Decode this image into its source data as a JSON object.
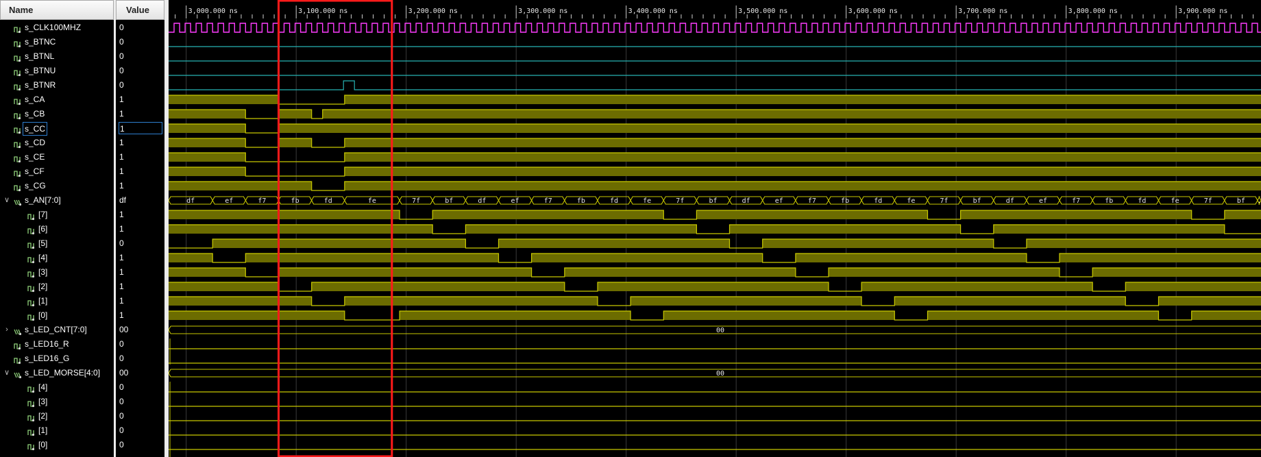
{
  "columns": {
    "name": "Name",
    "value": "Value"
  },
  "signals": [
    {
      "name": "s_CLK100MHZ",
      "value": "0",
      "kind": "bit",
      "indent": 0,
      "expander": ""
    },
    {
      "name": "s_BTNC",
      "value": "0",
      "kind": "bit",
      "indent": 0,
      "expander": ""
    },
    {
      "name": "s_BTNL",
      "value": "0",
      "kind": "bit",
      "indent": 0,
      "expander": ""
    },
    {
      "name": "s_BTNU",
      "value": "0",
      "kind": "bit",
      "indent": 0,
      "expander": ""
    },
    {
      "name": "s_BTNR",
      "value": "0",
      "kind": "bit",
      "indent": 0,
      "expander": ""
    },
    {
      "name": "s_CA",
      "value": "1",
      "kind": "bit",
      "indent": 0,
      "expander": ""
    },
    {
      "name": "s_CB",
      "value": "1",
      "kind": "bit",
      "indent": 0,
      "expander": ""
    },
    {
      "name": "s_CC",
      "value": "1",
      "kind": "bit",
      "indent": 0,
      "expander": "",
      "selected": true
    },
    {
      "name": "s_CD",
      "value": "1",
      "kind": "bit",
      "indent": 0,
      "expander": ""
    },
    {
      "name": "s_CE",
      "value": "1",
      "kind": "bit",
      "indent": 0,
      "expander": ""
    },
    {
      "name": "s_CF",
      "value": "1",
      "kind": "bit",
      "indent": 0,
      "expander": ""
    },
    {
      "name": "s_CG",
      "value": "1",
      "kind": "bit",
      "indent": 0,
      "expander": ""
    },
    {
      "name": "s_AN[7:0]",
      "value": "df",
      "kind": "bus",
      "indent": 0,
      "expander": "expanded"
    },
    {
      "name": "[7]",
      "value": "1",
      "kind": "bit",
      "indent": 1,
      "expander": ""
    },
    {
      "name": "[6]",
      "value": "1",
      "kind": "bit",
      "indent": 1,
      "expander": ""
    },
    {
      "name": "[5]",
      "value": "0",
      "kind": "bit",
      "indent": 1,
      "expander": ""
    },
    {
      "name": "[4]",
      "value": "1",
      "kind": "bit",
      "indent": 1,
      "expander": ""
    },
    {
      "name": "[3]",
      "value": "1",
      "kind": "bit",
      "indent": 1,
      "expander": ""
    },
    {
      "name": "[2]",
      "value": "1",
      "kind": "bit",
      "indent": 1,
      "expander": ""
    },
    {
      "name": "[1]",
      "value": "1",
      "kind": "bit",
      "indent": 1,
      "expander": ""
    },
    {
      "name": "[0]",
      "value": "1",
      "kind": "bit",
      "indent": 1,
      "expander": ""
    },
    {
      "name": "s_LED_CNT[7:0]",
      "value": "00",
      "kind": "bus",
      "indent": 0,
      "expander": "collapsed"
    },
    {
      "name": "s_LED16_R",
      "value": "0",
      "kind": "bit",
      "indent": 0,
      "expander": ""
    },
    {
      "name": "s_LED16_G",
      "value": "0",
      "kind": "bit",
      "indent": 0,
      "expander": ""
    },
    {
      "name": "s_LED_MORSE[4:0]",
      "value": "00",
      "kind": "bus",
      "indent": 0,
      "expander": "expanded"
    },
    {
      "name": "[4]",
      "value": "0",
      "kind": "bit",
      "indent": 1,
      "expander": ""
    },
    {
      "name": "[3]",
      "value": "0",
      "kind": "bit",
      "indent": 1,
      "expander": ""
    },
    {
      "name": "[2]",
      "value": "0",
      "kind": "bit",
      "indent": 1,
      "expander": ""
    },
    {
      "name": "[1]",
      "value": "0",
      "kind": "bit",
      "indent": 1,
      "expander": ""
    },
    {
      "name": "[0]",
      "value": "0",
      "kind": "bit",
      "indent": 1,
      "expander": ""
    }
  ],
  "timeline": {
    "unit": "ns",
    "start": 2984,
    "end": 3980,
    "ticks": [
      "3,000.000 ns",
      "3,100.000 ns",
      "3,200.000 ns",
      "3,300.000 ns",
      "3,400.000 ns",
      "3,500.000 ns",
      "3,600.000 ns",
      "3,700.000 ns",
      "3,800.000 ns",
      "3,900.000 ns"
    ],
    "tick_values": [
      3000,
      3100,
      3200,
      3300,
      3400,
      3500,
      3600,
      3700,
      3800,
      3900
    ],
    "highlight_range": [
      3084,
      3187
    ]
  },
  "clock": {
    "period": 10
  },
  "waves": {
    "s_BTNR": [
      [
        3143,
        1
      ],
      [
        3153,
        0
      ]
    ],
    "s_CA": [
      [
        3084,
        0
      ],
      [
        3144,
        1
      ]
    ],
    "s_CB": [
      [
        3054,
        0
      ],
      [
        3084,
        1
      ],
      [
        3114,
        0
      ],
      [
        3124,
        1
      ]
    ],
    "s_CC": [
      [
        3054,
        0
      ],
      [
        3084,
        1
      ]
    ],
    "s_CD": [
      [
        3054,
        0
      ],
      [
        3084,
        1
      ],
      [
        3114,
        0
      ],
      [
        3144,
        1
      ]
    ],
    "s_CE": [
      [
        3054,
        0
      ],
      [
        3144,
        1
      ]
    ],
    "s_CF": [
      [
        3054,
        0
      ],
      [
        3144,
        1
      ]
    ],
    "s_CG": [
      [
        3114,
        0
      ],
      [
        3144,
        1
      ]
    ],
    "an_bus": [
      {
        "t": 2984,
        "v": "df"
      },
      {
        "t": 3024,
        "v": "ef"
      },
      {
        "t": 3054,
        "v": "f7"
      },
      {
        "t": 3084,
        "v": "fb"
      },
      {
        "t": 3114,
        "v": "fd"
      },
      {
        "t": 3144,
        "v": "fe"
      },
      {
        "t": 3194,
        "v": "7f"
      },
      {
        "t": 3224,
        "v": "bf"
      },
      {
        "t": 3254,
        "v": "df"
      },
      {
        "t": 3284,
        "v": "ef"
      },
      {
        "t": 3314,
        "v": "f7"
      },
      {
        "t": 3344,
        "v": "fb"
      },
      {
        "t": 3374,
        "v": "fd"
      },
      {
        "t": 3404,
        "v": "fe"
      },
      {
        "t": 3434,
        "v": "7f"
      },
      {
        "t": 3464,
        "v": "bf"
      },
      {
        "t": 3494,
        "v": "df"
      },
      {
        "t": 3524,
        "v": "ef"
      },
      {
        "t": 3554,
        "v": "f7"
      },
      {
        "t": 3584,
        "v": "fb"
      },
      {
        "t": 3614,
        "v": "fd"
      },
      {
        "t": 3644,
        "v": "fe"
      },
      {
        "t": 3674,
        "v": "7f"
      },
      {
        "t": 3704,
        "v": "bf"
      },
      {
        "t": 3734,
        "v": "df"
      },
      {
        "t": 3764,
        "v": "ef"
      },
      {
        "t": 3794,
        "v": "f7"
      },
      {
        "t": 3824,
        "v": "fb"
      },
      {
        "t": 3854,
        "v": "fd"
      },
      {
        "t": 3884,
        "v": "fe"
      },
      {
        "t": 3914,
        "v": "7f"
      },
      {
        "t": 3944,
        "v": "bf"
      },
      {
        "t": 3974,
        "v": "."
      }
    ],
    "s_LED_CNT": "00",
    "s_LED_MORSE": "00"
  }
}
